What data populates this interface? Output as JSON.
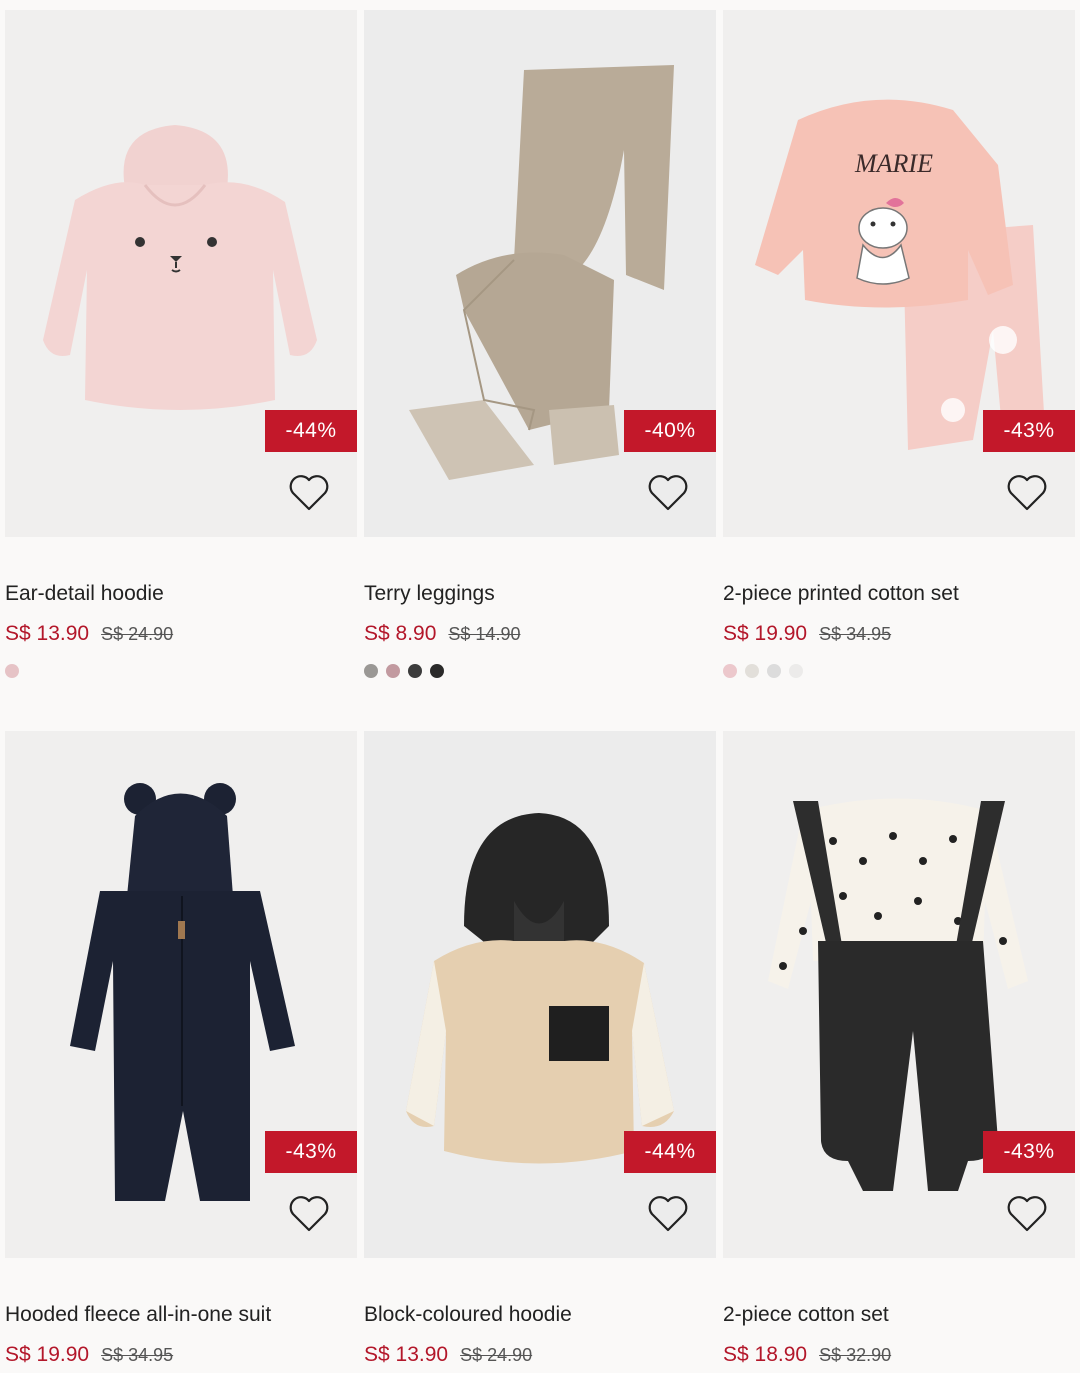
{
  "products": [
    {
      "title": "Ear-detail hoodie",
      "price": "S$ 13.90",
      "old_price": "S$ 24.90",
      "discount": "-44%",
      "swatches": [
        "#e6c3c6"
      ]
    },
    {
      "title": "Terry leggings",
      "price": "S$ 8.90",
      "old_price": "S$ 14.90",
      "discount": "-40%",
      "swatches": [
        "#9a9895",
        "#c29aa0",
        "#3c3c3c",
        "#2a2a2a"
      ]
    },
    {
      "title": "2-piece printed cotton set",
      "price": "S$ 19.90",
      "old_price": "S$ 34.95",
      "discount": "-43%",
      "swatches": [
        "#ecc8cc",
        "#e2dfda",
        "#dcdcdc",
        "#ecebea"
      ]
    },
    {
      "title": "Hooded fleece all-in-one suit",
      "price": "S$ 19.90",
      "old_price": "S$ 34.95",
      "discount": "-43%",
      "swatches": []
    },
    {
      "title": "Block-coloured hoodie",
      "price": "S$ 13.90",
      "old_price": "S$ 24.90",
      "discount": "-44%",
      "swatches": []
    },
    {
      "title": "2-piece cotton set",
      "price": "S$ 18.90",
      "old_price": "S$ 32.90",
      "discount": "-43%",
      "swatches": []
    }
  ],
  "icons": {
    "favorite": "heart-outline-icon"
  },
  "colors": {
    "price": "#b3172a",
    "badge": "#c3182a"
  }
}
